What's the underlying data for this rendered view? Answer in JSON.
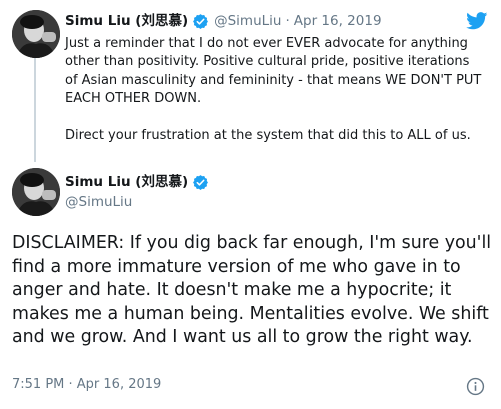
{
  "tweet1": {
    "author_name": "Simu Liu (刘思慕)",
    "handle": "@SimuLiu",
    "separator": "·",
    "date": "Apr 16, 2019",
    "text": "Just a reminder that I do not ever EVER advocate for anything other than positivity. Positive cultural pride, positive iterations of Asian masculinity and femininity - that means WE DON'T PUT EACH OTHER DOWN.\n\nDirect your frustration at the system that did this to ALL of us."
  },
  "tweet2": {
    "author_name": "Simu Liu (刘思慕)",
    "handle": "@SimuLiu",
    "text": "DISCLAIMER: If you dig back far enough, I'm sure you'll find a more immature version of me who gave in to anger and hate. It doesn't make me a hypocrite; it makes me a human being. Mentalities evolve. We shift and we grow. And I want us all to grow the right way.",
    "timestamp": "7:51 PM · Apr 16, 2019"
  },
  "icons": {
    "verified": "verified-badge-icon",
    "logo": "twitter-bird-icon",
    "info": "info-icon",
    "avatar": "avatar"
  },
  "colors": {
    "text": "#14171a",
    "secondary_text": "#657786",
    "brand_blue": "#1da1f2",
    "thread_line": "#ccd6dd"
  }
}
